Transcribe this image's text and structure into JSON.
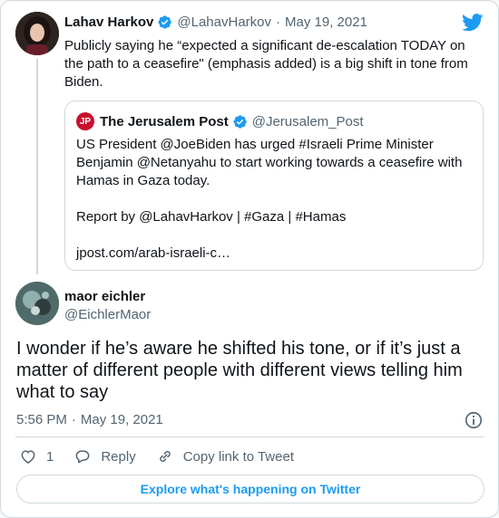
{
  "colors": {
    "accent": "#1d9bf0",
    "text": "#0f1419",
    "muted": "#536471",
    "border": "#cfd9de",
    "jpost_red": "#c8102e"
  },
  "parent_tweet": {
    "name": "Lahav Harkov",
    "handle": "@LahavHarkov",
    "date": "May 19, 2021",
    "separator": "·",
    "text": "Publicly saying he “expected a significant de-escalation TODAY on the path to a ceasefire\" (emphasis added) is a big shift in tone from Biden."
  },
  "quoted_tweet": {
    "logo_text": "JP",
    "name": "The Jerusalem Post",
    "handle": "@Jerusalem_Post",
    "line1": "US President @JoeBiden has urged #Israeli Prime Minister Benjamin @Netanyahu to start working towards a ceasefire with Hamas in Gaza today.",
    "line2": "Report by @LahavHarkov | #Gaza | #Hamas",
    "line3": "jpost.com/arab-israeli-c…"
  },
  "main_tweet": {
    "name": "maor eichler",
    "handle": "@EichlerMaor",
    "text": "I wonder if he’s aware he shifted his tone, or if it’s just a matter of different people with different views telling him what to say",
    "time": "5:56 PM",
    "separator": "·",
    "date": "May 19, 2021"
  },
  "actions": {
    "like_count": "1",
    "reply_label": "Reply",
    "copy_label": "Copy link to Tweet"
  },
  "explore_label": "Explore what's happening on Twitter",
  "icons": {
    "twitter": "twitter-bird-icon",
    "verified": "verified-badge-icon",
    "info": "info-icon",
    "like": "heart-icon",
    "reply": "reply-bubble-icon",
    "copy": "link-icon"
  }
}
